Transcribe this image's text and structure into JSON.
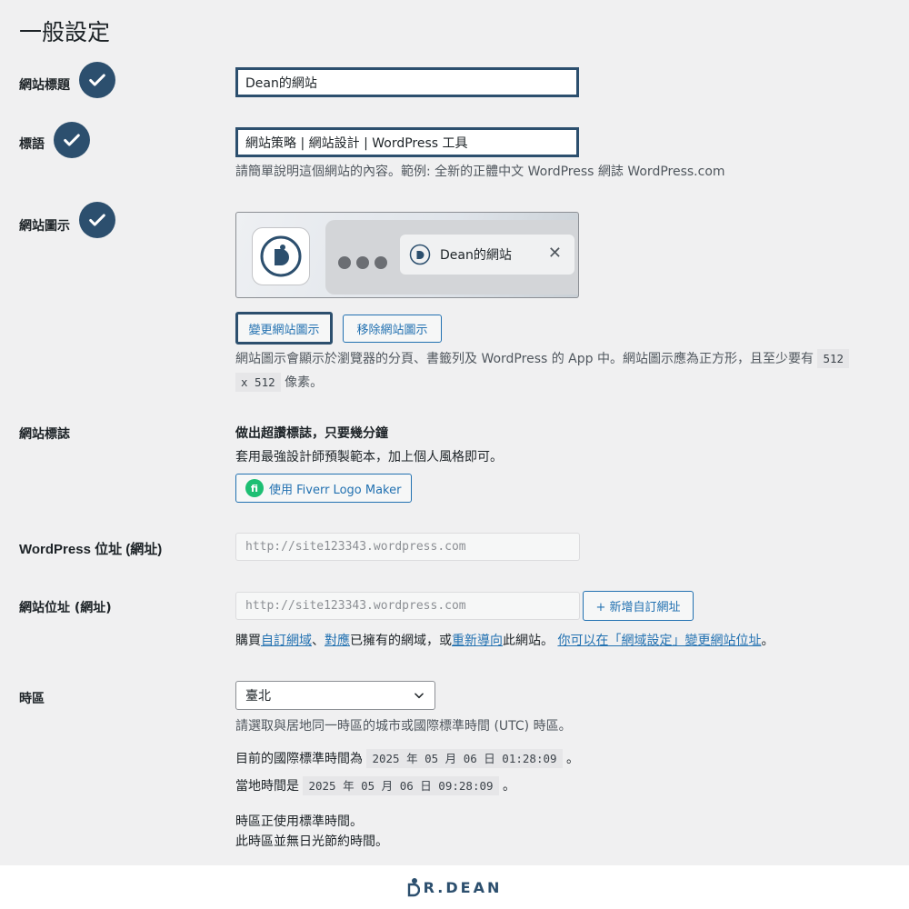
{
  "page_title": "一般設定",
  "site_title": {
    "label": "網站標題",
    "value": "Dean的網站"
  },
  "tagline": {
    "label": "標語",
    "value": "網站策略 | 網站設計 | WordPress 工具",
    "description": "請簡單說明這個網站的內容。範例: 全新的正體中文 WordPress 網誌 WordPress.com"
  },
  "site_icon": {
    "label": "網站圖示",
    "preview_tab_title": "Dean的網站",
    "change_button": "變更網站圖示",
    "remove_button": "移除網站圖示",
    "description_prefix": "網站圖示會顯示於瀏覽器的分頁、書籤列及 WordPress 的 App 中。網站圖示應為正方形，且至少要有",
    "size_code_a": "512",
    "size_code_b": "x 512",
    "description_suffix": "像素。"
  },
  "site_logo": {
    "label": "網站標誌",
    "heading": "做出超讚標誌，只要幾分鐘",
    "text": "套用最強設計師預製範本，加上個人風格即可。",
    "button": "使用 Fiverr Logo Maker",
    "button_icon_glyph": "fi"
  },
  "wp_address": {
    "label": "WordPress 位址 (網址)",
    "value": "http://site123343.wordpress.com"
  },
  "site_address": {
    "label": "網站位址 (網址)",
    "value": "http://site123343.wordpress.com",
    "add_button": "+ 新增自訂網址",
    "help_prefix": "購買",
    "link_custom_domain": "自訂網域",
    "sep1": "、",
    "link_map": "對應",
    "help_mid": "已擁有的網域，或",
    "link_redirect": "重新導向",
    "help_mid2": "此網站。",
    "link_domain_settings": "你可以在「網域設定」變更網站位址",
    "help_end": "。"
  },
  "timezone": {
    "label": "時區",
    "selected": "臺北",
    "description": "請選取與居地同一時區的城市或國際標準時間 (UTC) 時區。",
    "utc_prefix": "目前的國際標準時間為",
    "utc_time": "2025 年 05 月 06 日 01:28:09",
    "utc_suffix": "。",
    "local_prefix": "當地時間是",
    "local_time": "2025 年 05 月 06 日 09:28:09",
    "local_suffix": "。",
    "std_time_note": "時區正使用標準時間。",
    "dst_note": "此時區並無日光節約時間。"
  },
  "footer": {
    "brand": "R.DEAN"
  },
  "colors": {
    "accent_dark": "#2c4f6e",
    "link": "#2271b1",
    "fiverr_green": "#1dbf73"
  },
  "icons": [
    "checkmark-icon",
    "chevron-down-icon",
    "close-icon",
    "site-logo-icon",
    "fiverr-icon"
  ]
}
